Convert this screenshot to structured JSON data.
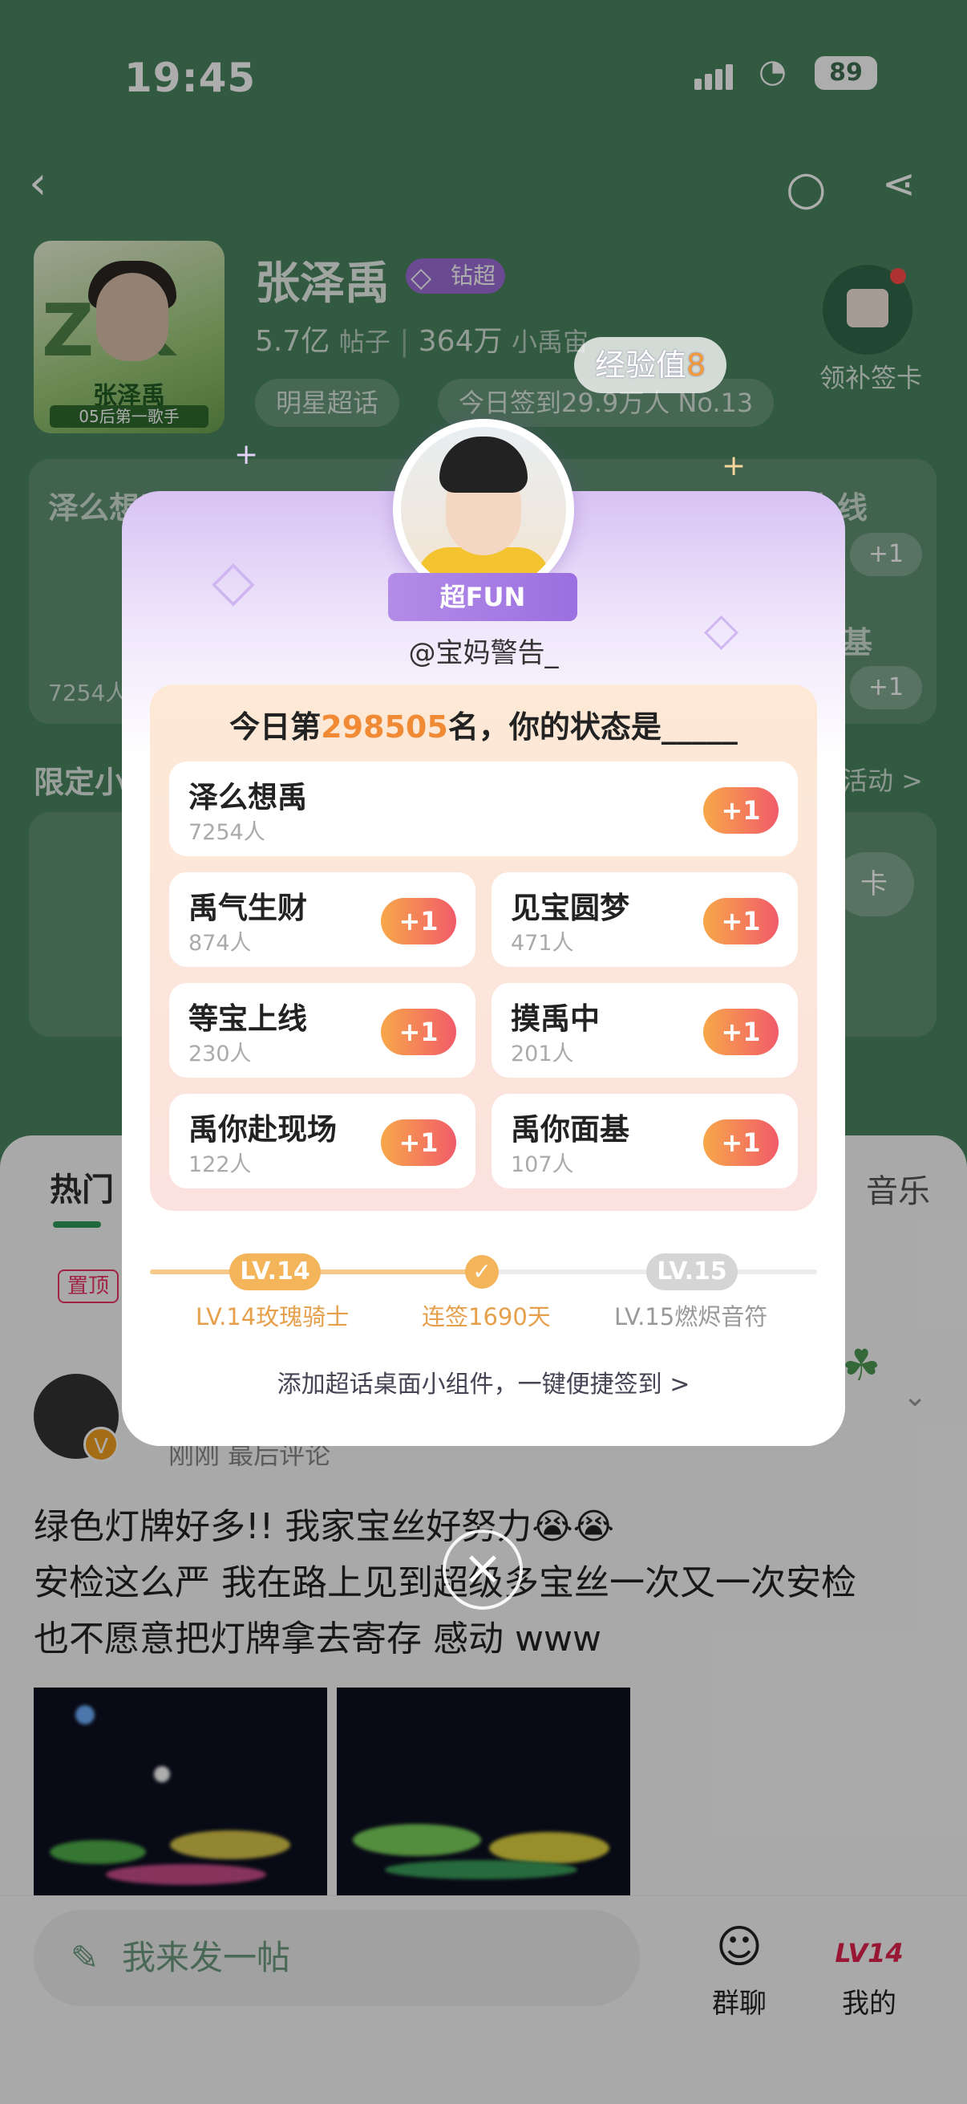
{
  "status_bar": {
    "time": "19:45",
    "battery": "89"
  },
  "header": {
    "title": "张泽禹",
    "badge": "钻超",
    "posts_count": "5.7亿",
    "posts_label": "帖子",
    "members_count": "364万",
    "members_label": "小禹宙",
    "tag": "明星超话",
    "checkin_stat": "今日签到29.9万人 No.13",
    "supplement_label": "领补签卡",
    "cover_caption": "张泽禹",
    "cover_subcaption": "05后第一歌手"
  },
  "background": {
    "card_left_title": "泽么想禹",
    "card_left_count": "7254人",
    "card_right_title": "等宝上线",
    "card_right_title2": "基",
    "limited_label": "限定小",
    "activity_link": "活动 >",
    "plus_one": "+1",
    "get_card": "卡"
  },
  "feed": {
    "tab_hot": "热门",
    "tab_music": "音乐",
    "pinned": "置顶",
    "post_time": "刚刚 最后评论",
    "post_line1": "绿色灯牌好多!!  我家宝丝好努力😭😭",
    "post_line2": "安检这么严 我在路上见到超级多宝丝一次又一次安检",
    "post_line3": "也不愿意把灯牌拿去寄存 感动 www"
  },
  "bottom": {
    "post_placeholder": "我来发一帖",
    "group_chat": "群聊",
    "mine": "我的",
    "mine_level": "LV14"
  },
  "modal": {
    "xp_label": "经验值",
    "xp_value": "8",
    "fun_badge": "超FUN",
    "username": "@宝妈警告_",
    "rank_prefix": "今日第",
    "rank_number": "298505",
    "rank_suffix": "名，你的状态是_____",
    "options": [
      {
        "name": "泽么想禹",
        "count": "7254人",
        "plus": "+1"
      },
      {
        "name": "禹气生财",
        "count": "874人",
        "plus": "+1"
      },
      {
        "name": "见宝圆梦",
        "count": "471人",
        "plus": "+1"
      },
      {
        "name": "等宝上线",
        "count": "230人",
        "plus": "+1"
      },
      {
        "name": "摸禹中",
        "count": "201人",
        "plus": "+1"
      },
      {
        "name": "禹你赴现场",
        "count": "122人",
        "plus": "+1"
      },
      {
        "name": "禹你面基",
        "count": "107人",
        "plus": "+1"
      }
    ],
    "level_current": "LV.14",
    "level_next": "LV.15",
    "level_current_name": "LV.14玫瑰骑士",
    "streak": "连签1690天",
    "level_next_name": "LV.15燃烬音符",
    "widget_link": "添加超话桌面小组件，一键便捷签到 >"
  },
  "colors": {
    "accent_orange": "#f08a34",
    "page_green": "#4a8560",
    "plus_gradient_start": "#f7a84a",
    "plus_gradient_end": "#f15b69",
    "purple": "#9b6fe0"
  }
}
